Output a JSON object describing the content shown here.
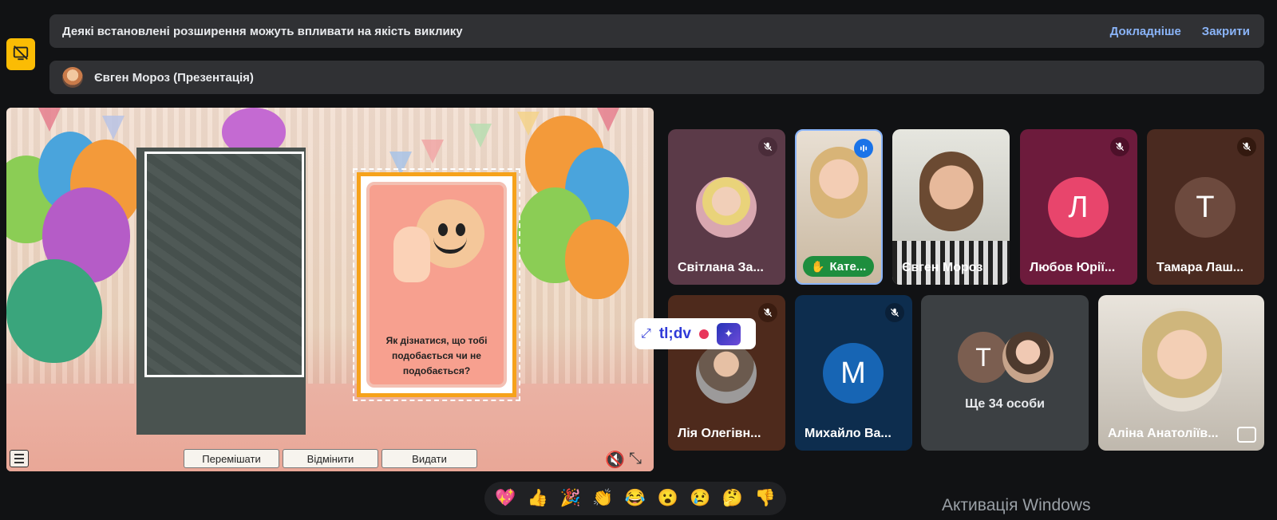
{
  "warning_banner": {
    "text": "Деякі встановлені розширення можуть впливати на якість виклику",
    "learn_more": "Докладніше",
    "close": "Закрити"
  },
  "presenter_banner": {
    "text": "Євген Мороз (Презентація)"
  },
  "presentation": {
    "card_question": "Як дізнатися, що тобі подобається чи не подобається?",
    "buttons": {
      "shuffle": "Перемішати",
      "undo": "Відмінити",
      "deal": "Видати"
    }
  },
  "participants": [
    {
      "name": "Світлана За...",
      "muted": true
    },
    {
      "name": "Кате...",
      "hand_raised": true,
      "speaking": true
    },
    {
      "name": "Євген Мороз"
    },
    {
      "name": "Любов Юрії...",
      "initial": "Л",
      "muted": true
    },
    {
      "name": "Тамара Лаш...",
      "initial": "Т",
      "muted": true
    },
    {
      "name": "Лія Олегівн...",
      "muted": true
    },
    {
      "name": "Михайло Ва...",
      "initial": "M",
      "muted": true
    },
    {
      "name": "Аліна Анатоліїв..."
    }
  ],
  "more_tile": {
    "initial": "Т",
    "text": "Ще 34 особи"
  },
  "tldv": {
    "logo": "tl;dv"
  },
  "reactions": [
    "💖",
    "👍",
    "🎉",
    "👏",
    "😂",
    "😮",
    "😢",
    "🤔",
    "👎"
  ],
  "watermark": "Активація Windows"
}
